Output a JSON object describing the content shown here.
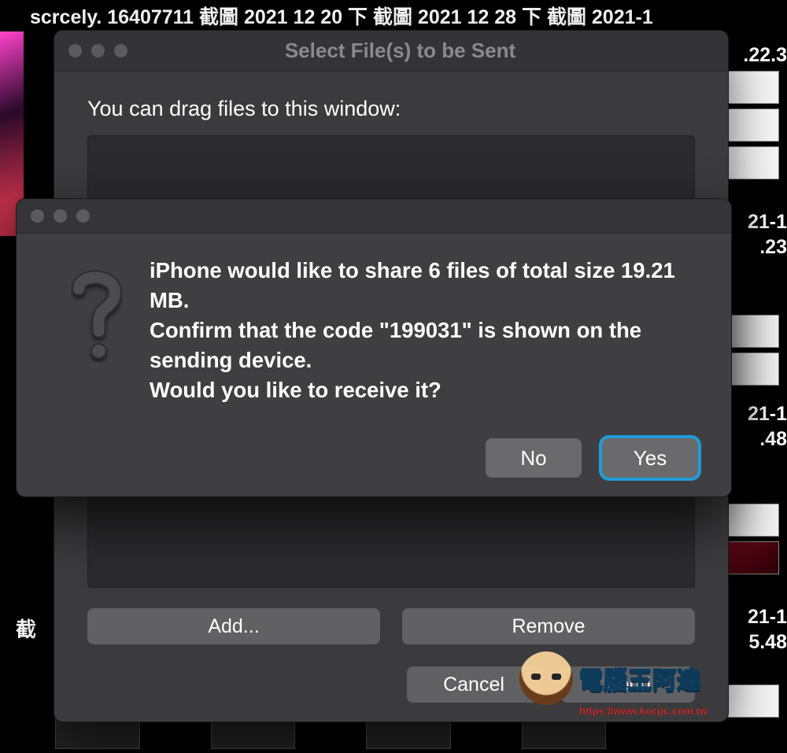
{
  "desktop": {
    "top_text": "scrcely. 16407711    截圖 2021 12 20 下    截圖 2021 12 28 下    截圖 2021-1",
    "right_labels": [
      ".22.3",
      "21-1",
      ".23",
      "21-1",
      ".48",
      "21-1",
      "5.48"
    ],
    "bottom_label": "截"
  },
  "window": {
    "title": "Select File(s) to be Sent",
    "drag_hint": "You can drag files to this window:",
    "buttons": {
      "add": "Add...",
      "remove": "Remove",
      "cancel": "Cancel",
      "send": "Send"
    }
  },
  "alert": {
    "message": "iPhone would like to share 6 files of total size 19.21 MB.\nConfirm that the code \"199031\" is shown on the sending device.\nWould you like to receive it?",
    "no": "No",
    "yes": "Yes"
  },
  "watermark": {
    "text": "電腦王阿達",
    "sub": "https://www.kocpc.com.tw"
  }
}
